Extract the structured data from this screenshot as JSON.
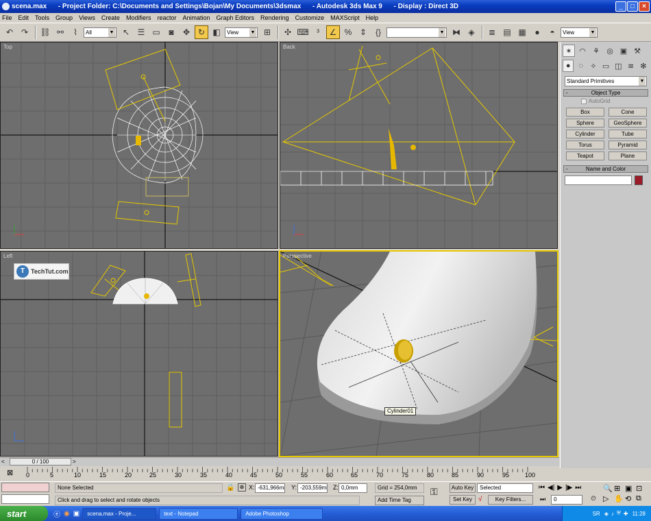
{
  "window": {
    "title": "scena.max      - Project Folder: C:\\Documents and Settings\\Bojan\\My Documents\\3dsmax      - Autodesk 3ds Max 9      - Display : Direct 3D",
    "minimize": "_",
    "maximize": "□",
    "close": "×"
  },
  "menu": [
    "File",
    "Edit",
    "Tools",
    "Group",
    "Views",
    "Create",
    "Modifiers",
    "reactor",
    "Animation",
    "Graph Editors",
    "Rendering",
    "Customize",
    "MAXScript",
    "Help"
  ],
  "toolbar": {
    "selection_filter": "All",
    "ref_coord": "View",
    "named_selection": "",
    "view_right": "View"
  },
  "viewports": {
    "top": "Top",
    "back": "Back",
    "left": "Left",
    "perspective": "Perspective",
    "tooltip": "Cylinder01",
    "watermark": "TechTut.com"
  },
  "command_panel": {
    "category": "Standard Primitives",
    "object_type_header": "Object Type",
    "autogrid": "AutoGrid",
    "buttons": [
      "Box",
      "Cone",
      "Sphere",
      "GeoSphere",
      "Cylinder",
      "Tube",
      "Torus",
      "Pyramid",
      "Teapot",
      "Plane"
    ],
    "name_color_header": "Name and Color",
    "name_value": "",
    "color": "#9b1b28"
  },
  "timeline": {
    "frame": "0 / 100",
    "ticks": [
      "0",
      "5",
      "10",
      "15",
      "20",
      "25",
      "30",
      "35",
      "40",
      "45",
      "50",
      "55",
      "60",
      "65",
      "70",
      "75",
      "80",
      "85",
      "90",
      "95",
      "100"
    ]
  },
  "status": {
    "selection": "None Selected",
    "prompt": "Click and drag to select and rotate objects",
    "x_label": "X:",
    "x_value": "-631,966mi",
    "y_label": "Y:",
    "y_value": "-203,559mi",
    "z_label": "Z:",
    "z_value": "0,0mm",
    "grid": "Grid = 254,0mm",
    "add_time_tag": "Add Time Tag",
    "auto_key": "Auto Key",
    "set_key": "Set Key",
    "key_mode": "Selected",
    "key_filters": "Key Filters...",
    "current_frame": "0"
  },
  "taskbar": {
    "start": "start",
    "tasks": [
      "scena.max    - Proje...",
      "text - Notepad",
      "Adobe Photoshop"
    ],
    "lang": "SR",
    "clock": "11:28"
  }
}
